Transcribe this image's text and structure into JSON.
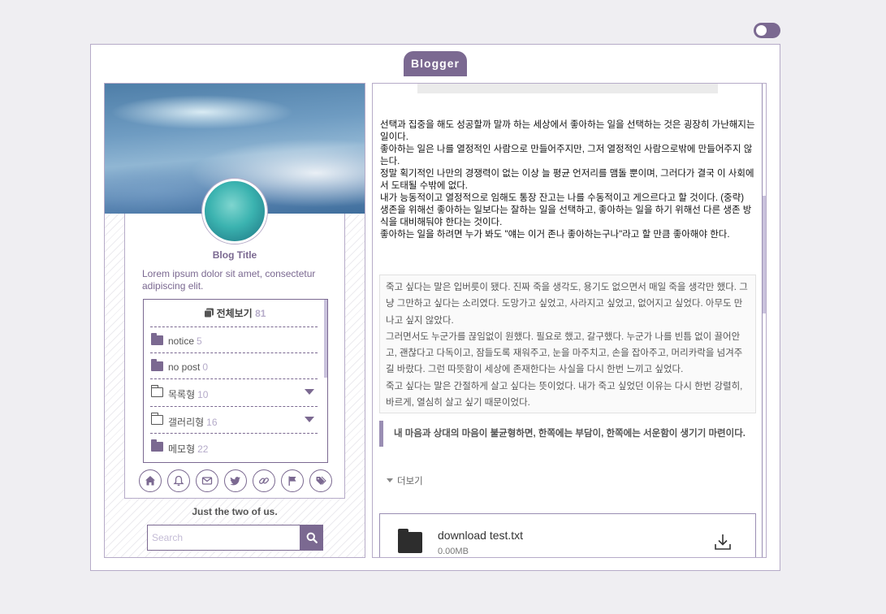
{
  "theme": {
    "accent": "#7b6991",
    "accent_light": "#b5abc9",
    "border": "#b6abc8"
  },
  "toggle": {
    "state": "on"
  },
  "brand": {
    "label": "Blogger"
  },
  "sidebar": {
    "blog_title": "Blog Title",
    "description": "Lorem ipsum dolor sit amet, consectetur adipiscing elit.",
    "categories_all": {
      "label": "전체보기",
      "count": "81",
      "icon": "copy-icon"
    },
    "categories": [
      {
        "label": "notice",
        "count": "5",
        "icon": "folder-filled-icon",
        "expandable": false
      },
      {
        "label": "no post",
        "count": "0",
        "icon": "folder-filled-icon",
        "expandable": false
      },
      {
        "label": "목록형",
        "count": "10",
        "icon": "folder-outline-icon",
        "expandable": true
      },
      {
        "label": "갤러리형",
        "count": "16",
        "icon": "folder-outline-icon",
        "expandable": true
      },
      {
        "label": "메모형",
        "count": "22",
        "icon": "folder-filled-icon",
        "expandable": false
      }
    ],
    "social_icons": [
      "home-icon",
      "bell-icon",
      "mail-icon",
      "twitter-icon",
      "link-icon",
      "flag-icon",
      "tag-icon"
    ],
    "tagline": "Just the two of us.",
    "search": {
      "placeholder": "Search",
      "value": "",
      "button_icon": "search-icon"
    }
  },
  "content": {
    "paragraphs": [
      "선택과 집중을 해도 성공할까 말까 하는 세상에서 좋아하는 일을 선택하는 것은 굉장히 가난해지는 일이다.",
      "좋아하는 일은 나를 열정적인 사람으로 만들어주지만, 그저 열정적인 사람으로밖에 만들어주지 않는다.",
      "정말 획기적인 나만의 경쟁력이 없는 이상 늘 평균 언저리를 맴돌 뿐이며, 그러다가 결국 이 사회에서 도태될 수밖에 없다.",
      "내가 능동적이고 열정적으로 임해도 통장 잔고는 나를 수동적이고 게으르다고 할 것이다. (중략)",
      "생존을 위해선 좋아하는 일보다는 잘하는 일을 선택하고, 좋아하는 일을 하기 위해선 다른 생존 방식을 대비해둬야 한다는 것이다.",
      "좋아하는 일을 하려면 누가 봐도 \"얘는 이거 존나 좋아하는구나\"라고 할 만큼 좋아해야 한다."
    ],
    "quote_box": [
      "죽고 싶다는 말은 입버릇이 됐다. 진짜 죽을 생각도, 용기도 없으면서 매일 죽을 생각만 했다. 그냥 그만하고 싶다는 소리였다. 도망가고 싶었고, 사라지고 싶었고, 없어지고 싶었다. 아무도 만나고 싶지 않았다.",
      "그러면서도 누군가를 끊임없이 원했다. 필요로 했고, 갈구했다. 누군가 나를 빈틈 없이 끌어안고, 괜찮다고 다독이고, 잠들도록 재워주고, 눈을 마주치고, 손을 잡아주고, 머리카락을 넘겨주길 바랐다. 그런 따뜻함이 세상에 존재한다는 사실을 다시 한번 느끼고 싶었다.",
      "죽고 싶다는 말은 간절하게 살고 싶다는 뜻이었다. 내가 죽고 싶었던 이유는 다시 한번 강렬히, 바르게, 열심히 살고 싶기 때문이었다."
    ],
    "blockquote": "내 마음과 상대의 마음이 불균형하면, 한쪽에는 부담이, 한쪽에는 서운함이 생기기 마련이다.",
    "more_label": "더보기",
    "attachment": {
      "name": "download test.txt",
      "size": "0.00MB",
      "icon": "folder-icon",
      "action_icon": "download-icon"
    }
  }
}
